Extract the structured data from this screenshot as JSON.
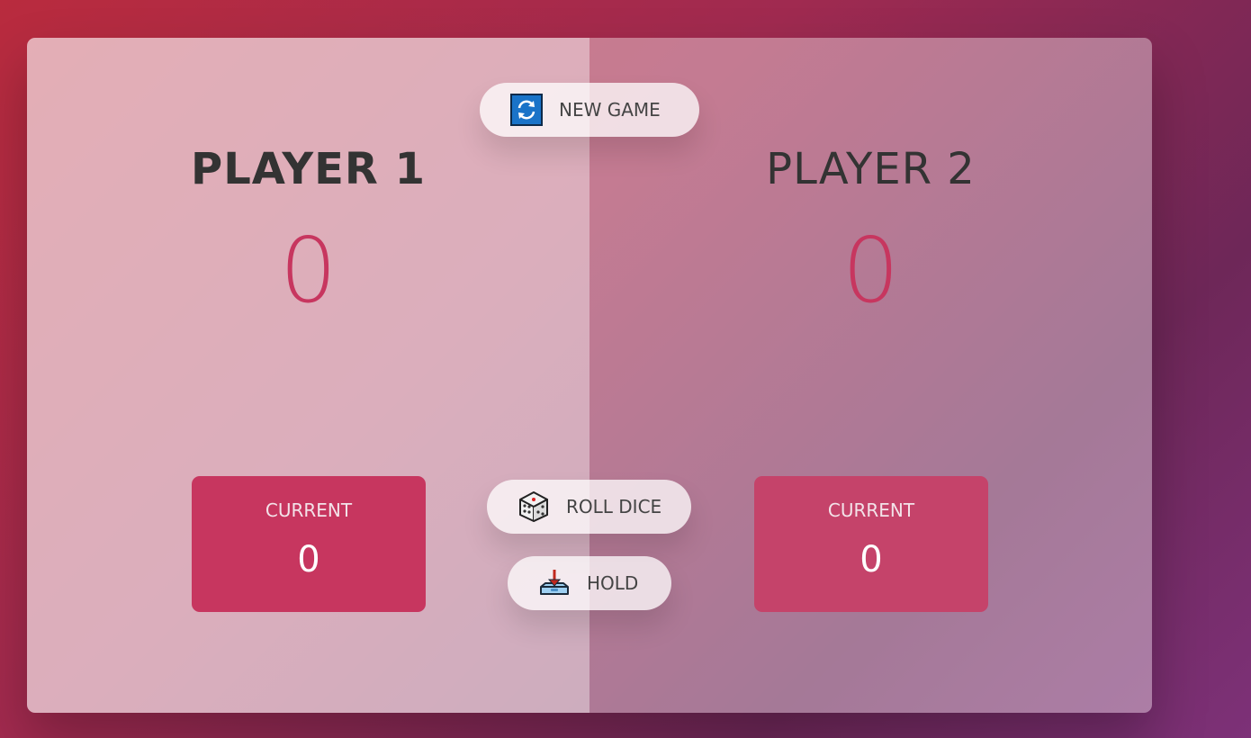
{
  "buttons": {
    "new_game": {
      "label": "NEW GAME",
      "icon": "refresh-icon"
    },
    "roll_dice": {
      "label": "ROLL DICE",
      "icon": "dice-icon"
    },
    "hold": {
      "label": "HOLD",
      "icon": "download-tray-icon"
    }
  },
  "players": [
    {
      "name": "PLAYER 1",
      "score": "0",
      "current_label": "CURRENT",
      "current_score": "0",
      "active": true
    },
    {
      "name": "PLAYER 2",
      "score": "0",
      "current_label": "CURRENT",
      "current_score": "0",
      "active": false
    }
  ],
  "colors": {
    "accent": "#c7365f",
    "current_box_active": "#c7365f",
    "current_box_inactive": "#c5436a",
    "refresh_icon_bg": "#1a73c8"
  }
}
